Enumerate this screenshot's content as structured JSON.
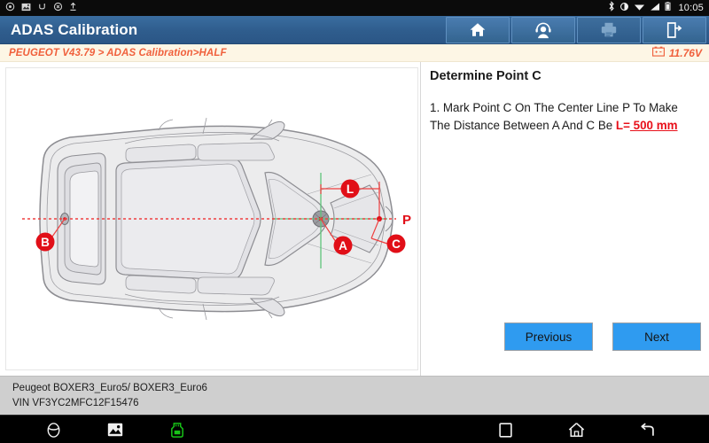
{
  "statusbar": {
    "left_icons": [
      "sync-icon",
      "screenshot-icon",
      "usb-icon",
      "mute-icon",
      "upload-icon"
    ],
    "right_icons": [
      "bluetooth-icon",
      "brightness-icon",
      "wifi-icon",
      "signal-icon",
      "battery-icon"
    ],
    "time": "10:05"
  },
  "header": {
    "title": "ADAS Calibration",
    "buttons": [
      {
        "name": "home-button",
        "icon": "home-icon",
        "enabled": true
      },
      {
        "name": "support-button",
        "icon": "headset-person-icon",
        "enabled": true
      },
      {
        "name": "print-button",
        "icon": "printer-icon",
        "enabled": false
      },
      {
        "name": "exit-button",
        "icon": "exit-door-icon",
        "enabled": true
      }
    ]
  },
  "breadcrumb": {
    "path": "PEUGEOT V43.79 > ADAS Calibration>HALF",
    "battery_icon": "battery-voltage-icon",
    "voltage": "11.76V"
  },
  "info": {
    "title": "Determine Point C",
    "step_text_1": "1. Mark Point C On The Center Line P To Make The Distance Between A And C Be ",
    "highlight_label": "L=",
    "highlight_value": " 500 mm",
    "previous_label": "Previous",
    "next_label": "Next"
  },
  "diagram": {
    "name": "adas-vehicle-top-view-diagram",
    "markers": [
      {
        "id": "B",
        "label": "B",
        "desc": "rear center reference point"
      },
      {
        "id": "A",
        "label": "A",
        "desc": "front center reference point"
      },
      {
        "id": "L",
        "label": "L",
        "desc": "distance dimension between A and C"
      },
      {
        "id": "C",
        "label": "C",
        "desc": "target point on center line P"
      },
      {
        "id": "P",
        "label": "P",
        "desc": "vehicle center line"
      }
    ],
    "colors": {
      "center_line": "#ef4040",
      "marker_fill": "#e10f18",
      "vehicle_stroke": "#8d8d92",
      "vehicle_fill": "#e9e9ec",
      "axis_green": "#4fbf6a"
    }
  },
  "vehicle": {
    "model": "Peugeot BOXER3_Euro5/ BOXER3_Euro6",
    "vin": "VIN VF3YC2MFC12F15476"
  },
  "navbar": {
    "items": [
      {
        "name": "browser-icon",
        "label": "browser"
      },
      {
        "name": "screenshot-icon",
        "label": "screenshot"
      },
      {
        "name": "vci-connection-icon",
        "label": "VCI"
      },
      {
        "name": "recents-icon",
        "label": "recents"
      },
      {
        "name": "home-icon",
        "label": "home"
      },
      {
        "name": "back-icon",
        "label": "back"
      }
    ]
  }
}
